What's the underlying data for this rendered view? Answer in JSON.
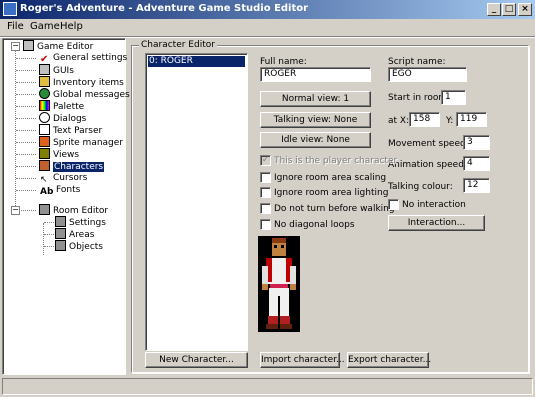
{
  "window": {
    "title": "Roger's Adventure - Adventure Game Studio Editor",
    "buttons": [
      "_",
      "□",
      "×"
    ]
  },
  "menubar": {
    "items": [
      "File",
      "Game",
      "Help"
    ]
  },
  "tree": {
    "root": "Game Editor",
    "items": [
      {
        "label": "General settings",
        "icon": "checkmark-icon"
      },
      {
        "label": "GUIs",
        "icon": "gui-icon"
      },
      {
        "label": "Inventory items",
        "icon": "key-icon"
      },
      {
        "label": "Global messages",
        "icon": "globe-icon"
      },
      {
        "label": "Palette",
        "icon": "palette-icon"
      },
      {
        "label": "Dialogs",
        "icon": "dialog-icon"
      },
      {
        "label": "Text Parser",
        "icon": "text-parser-icon"
      },
      {
        "label": "Sprite manager",
        "icon": "sprite-icon"
      },
      {
        "label": "Views",
        "icon": "views-icon"
      },
      {
        "label": "Characters",
        "icon": "characters-icon"
      },
      {
        "label": "Cursors",
        "icon": "cursor-icon"
      },
      {
        "label": "Fonts",
        "icon": "fonts-icon"
      }
    ],
    "room_editor": {
      "label": "Room Editor",
      "children": [
        "Settings",
        "Areas",
        "Objects"
      ]
    },
    "font_glyph": "Ab"
  },
  "editor": {
    "group_title": "Character Editor",
    "character_list": [
      "0: ROGER"
    ],
    "full_name_label": "Full name:",
    "full_name": "ROGER",
    "script_name_label": "Script name:",
    "script_name": "EGO",
    "normal_view": "Normal view: 1",
    "talking_view": "Talking view: None",
    "idle_view": "Idle view: None",
    "start_room_label": "Start in room",
    "start_room": "1",
    "at_x_label": "at X:",
    "at_x": "158",
    "at_y_label": "Y:",
    "at_y": "119",
    "movement_speed_label": "Movement speed:",
    "movement_speed": "3",
    "animation_speed_label": "Animation speed:",
    "animation_speed": "4",
    "talking_colour_label": "Talking colour:",
    "talking_colour": "12",
    "checkboxes": [
      {
        "label": "This is the player character",
        "checked": true,
        "disabled": true
      },
      {
        "label": "Ignore room area scaling",
        "checked": false
      },
      {
        "label": "Ignore room area lighting",
        "checked": false
      },
      {
        "label": "Do not turn before walking",
        "checked": false
      },
      {
        "label": "No diagonal loops",
        "checked": false
      }
    ],
    "no_interaction_label": "No interaction",
    "interaction_button": "Interaction...",
    "new_character": "New Character...",
    "import_character": "Import character...",
    "export_character": "Export character...",
    "check_glyph": "✓"
  },
  "colors": {
    "titlebar_start": "#0a246a",
    "titlebar_end": "#a6caf0",
    "selection": "#0a246a",
    "face": "#d4d0c8"
  }
}
